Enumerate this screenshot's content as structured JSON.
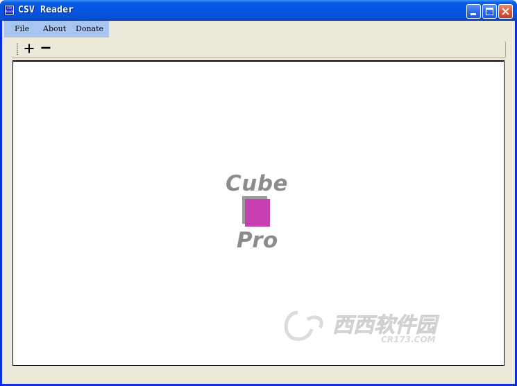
{
  "window": {
    "title": "CSV Reader",
    "icon_text": "CSV Reader",
    "buttons": [
      "minimize",
      "maximize",
      "close"
    ]
  },
  "menu": {
    "items": [
      {
        "label": "File"
      },
      {
        "label": "About"
      },
      {
        "label": "Donate"
      }
    ]
  },
  "toolbar": {
    "buttons": [
      {
        "icon": "plus-icon",
        "glyph": "+"
      },
      {
        "icon": "minus-icon",
        "glyph": "−"
      }
    ]
  },
  "content": {
    "logo": {
      "top_text": "Cube",
      "bottom_text": "Pro",
      "cube_color": "#c73fb1",
      "text_color": "#8c8c8c"
    },
    "watermark": {
      "text": "西西软件园",
      "subtext": "CR173.COM"
    }
  },
  "colors": {
    "titlebar": "#0a5fe4",
    "menubar_highlight": "#a8c4f0",
    "window_face": "#ece9d8"
  }
}
